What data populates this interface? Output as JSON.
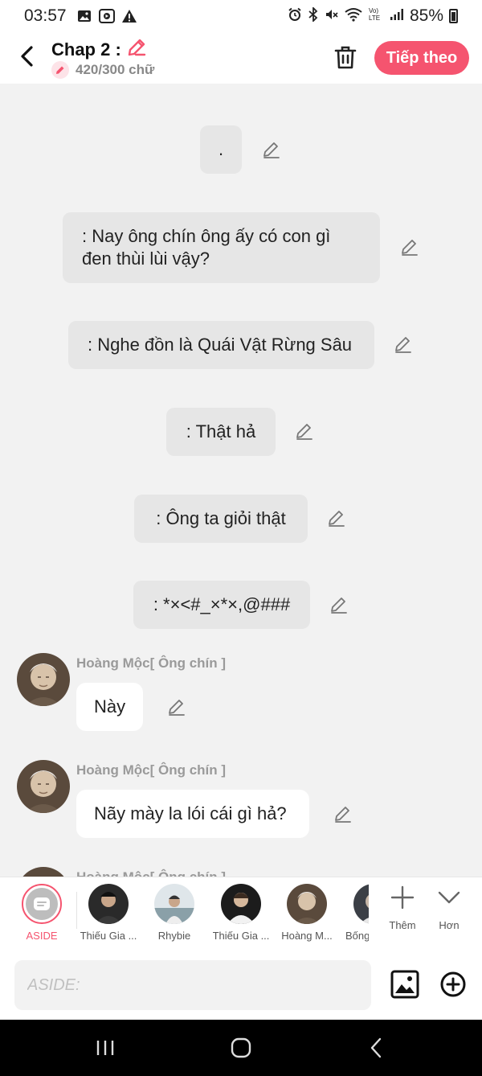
{
  "status_bar": {
    "time": "03:57",
    "battery": "85%",
    "icons": [
      "gallery-icon",
      "sdk-icon",
      "warning-icon",
      "alarm-icon",
      "bluetooth-icon",
      "mute-icon",
      "wifi-icon",
      "volte-icon",
      "signal-icon",
      "battery-icon"
    ]
  },
  "header": {
    "title": "Chap 2 :",
    "word_count": "420/300 chữ",
    "next_label": "Tiếp theo",
    "accent_color": "#f5546f"
  },
  "messages": {
    "narration": [
      ".",
      ": Nay ông chín ông ấy có con gì đen thùi lùi vậy?",
      ": Nghe đồn là Quái Vật Rừng Sâu",
      ": Thật hả",
      ": Ông ta giỏi thật",
      ": *×<#_×*×,@###"
    ],
    "dialogue": [
      {
        "speaker": "Hoàng Mộc[ Ông chín ]",
        "text": "Này"
      },
      {
        "speaker": "Hoàng Mộc[ Ông chín ]",
        "text": "Nãy mày la lói cái gì hả?"
      },
      {
        "speaker": "Hoàng Mộc[ Ông chín ]"
      }
    ]
  },
  "characters": [
    {
      "name": "ASIDE",
      "selected": true
    },
    {
      "name": "Thiếu Gia ..."
    },
    {
      "name": "Rhybie"
    },
    {
      "name": "Thiếu Gia ..."
    },
    {
      "name": "Hoàng M..."
    },
    {
      "name": "Bống"
    }
  ],
  "tools": {
    "add_label": "Thêm",
    "more_label": "Hơn"
  },
  "composer": {
    "placeholder": "ASIDE:"
  }
}
